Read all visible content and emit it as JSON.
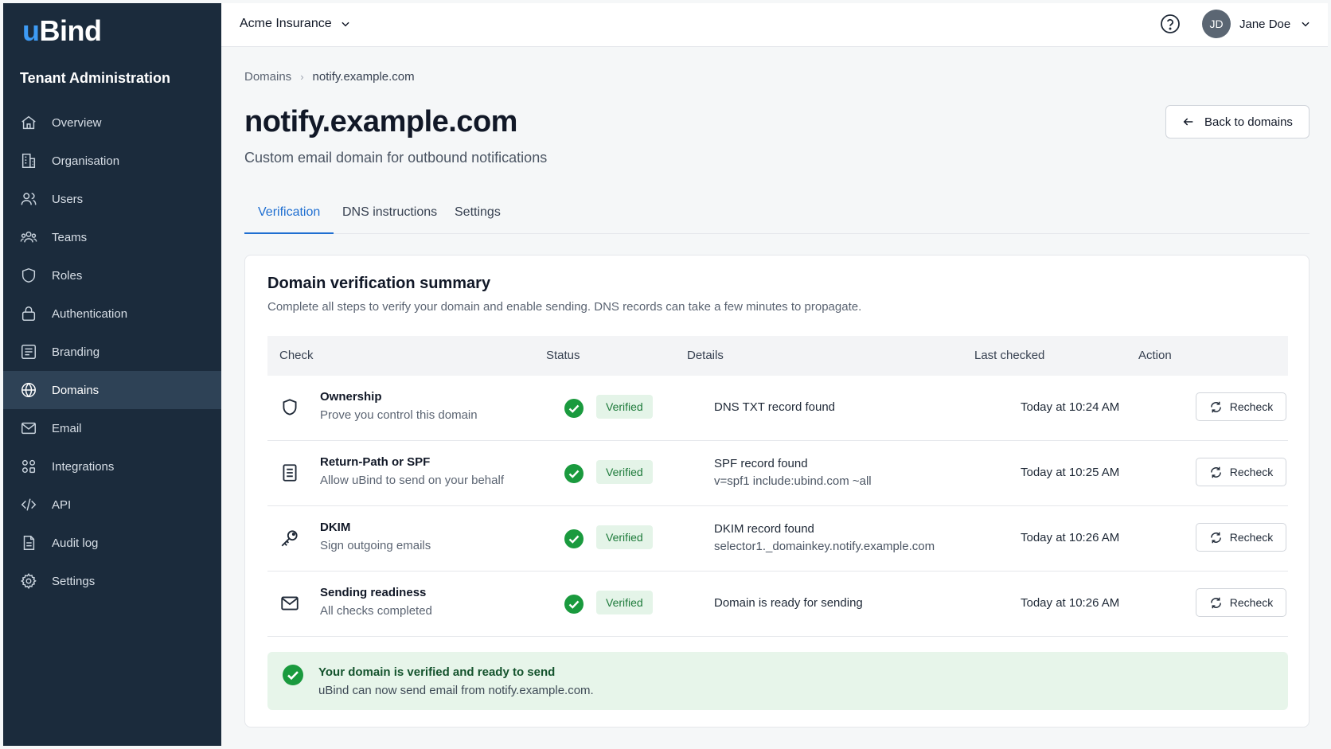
{
  "brand": {
    "logo_u": "u",
    "logo_rest": "Bind"
  },
  "sidebar": {
    "section_title": "Tenant Administration",
    "items": [
      {
        "label": "Overview",
        "icon": "home-icon"
      },
      {
        "label": "Organisation",
        "icon": "building-icon"
      },
      {
        "label": "Users",
        "icon": "users-icon"
      },
      {
        "label": "Teams",
        "icon": "teams-icon"
      },
      {
        "label": "Roles",
        "icon": "shield-icon"
      },
      {
        "label": "Authentication",
        "icon": "lock-icon"
      },
      {
        "label": "Branding",
        "icon": "palette-icon"
      },
      {
        "label": "Domains",
        "icon": "globe-icon",
        "active": true
      },
      {
        "label": "Email",
        "icon": "mail-icon"
      },
      {
        "label": "Integrations",
        "icon": "integrations-icon"
      },
      {
        "label": "API",
        "icon": "code-icon"
      },
      {
        "label": "Audit log",
        "icon": "document-icon"
      },
      {
        "label": "Settings",
        "icon": "gear-icon"
      }
    ]
  },
  "topbar": {
    "tenant": "Acme Insurance",
    "user_initials": "JD",
    "user_name": "Jane Doe"
  },
  "breadcrumb": {
    "parent": "Domains",
    "current": "notify.example.com"
  },
  "page": {
    "title": "notify.example.com",
    "subtitle": "Custom email domain for outbound notifications",
    "back_label": "Back to domains"
  },
  "tabs": [
    {
      "label": "Verification",
      "active": true
    },
    {
      "label": "DNS instructions"
    },
    {
      "label": "Settings"
    }
  ],
  "summary": {
    "title": "Domain verification summary",
    "description": "Complete all steps to verify your domain and enable sending. DNS records can take a few minutes to propagate.",
    "columns": {
      "check": "Check",
      "status": "Status",
      "details": "Details",
      "last_checked": "Last checked",
      "action": "Action"
    },
    "rows": [
      {
        "icon": "shield-icon",
        "name": "Ownership",
        "desc": "Prove you control this domain",
        "status": "Verified",
        "details": "DNS TXT record found",
        "details_extra": "",
        "last_checked": "Today at 10:24 AM",
        "action": "Recheck"
      },
      {
        "icon": "document-icon",
        "name": "Return-Path or SPF",
        "desc": "Allow uBind to send on your behalf",
        "status": "Verified",
        "details": "SPF record found",
        "details_extra": "v=spf1 include:ubind.com ~all",
        "last_checked": "Today at 10:25 AM",
        "action": "Recheck"
      },
      {
        "icon": "key-icon",
        "name": "DKIM",
        "desc": "Sign outgoing emails",
        "status": "Verified",
        "details": "DKIM record found",
        "details_extra": "selector1._domainkey.notify.example.com",
        "last_checked": "Today at 10:26 AM",
        "action": "Recheck"
      },
      {
        "icon": "mail-icon",
        "name": "Sending readiness",
        "desc": "All checks completed",
        "status": "Verified",
        "details": "Domain is ready for sending",
        "details_extra": "",
        "last_checked": "Today at 10:26 AM",
        "action": "Recheck"
      }
    ]
  },
  "banner": {
    "title": "Your domain is verified and ready to send",
    "text": "uBind can now send email from notify.example.com."
  },
  "colors": {
    "sidebar_bg": "#1b2b3c",
    "sidebar_active": "#2e4256",
    "accent": "#1f6fd1",
    "success": "#1a9a3e",
    "success_bg": "#e4f4e8"
  }
}
